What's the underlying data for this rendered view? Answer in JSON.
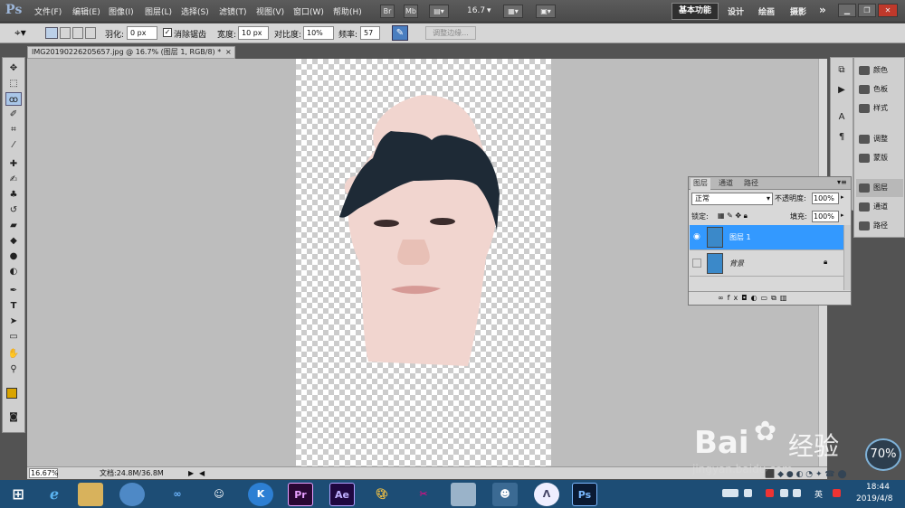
{
  "app": {
    "logo": "Ps"
  },
  "menu": [
    "文件(F)",
    "编辑(E)",
    "图像(I)",
    "图层(L)",
    "选择(S)",
    "滤镜(T)",
    "视图(V)",
    "窗口(W)",
    "帮助(H)"
  ],
  "appbar": {
    "br": "Br",
    "mb": "Mb",
    "zoom": "16.7",
    "workspaces": [
      "基本功能",
      "设计",
      "绘画",
      "摄影"
    ],
    "more": "»"
  },
  "options": {
    "feather_label": "羽化:",
    "feather_value": "0 px",
    "antialias_label": "消除锯齿",
    "width_label": "宽度:",
    "width_value": "10 px",
    "contrast_label": "对比度:",
    "contrast_value": "10%",
    "freq_label": "频率:",
    "freq_value": "57",
    "refine_label": "调整边缘..."
  },
  "document": {
    "tab_title": "IMG20190226205657.jpg @ 16.7% (图层 1, RGB/8) *",
    "close": "×"
  },
  "status": {
    "zoom": "16.67%",
    "doc": "文档:24.8M/36.8M"
  },
  "panels": {
    "right_items": [
      "颜色",
      "色板",
      "样式",
      "调整",
      "蒙版",
      "图层",
      "通道",
      "路径"
    ]
  },
  "layers_panel": {
    "tabs": [
      "图层",
      "通道",
      "路径"
    ],
    "blend_mode": "正常",
    "opacity_label": "不透明度:",
    "opacity_value": "100%",
    "lock_label": "锁定:",
    "fill_label": "填充:",
    "fill_value": "100%",
    "layers": [
      {
        "name": "图层 1",
        "selected": true,
        "visible": true
      },
      {
        "name": "背景",
        "selected": false,
        "visible": false,
        "locked": true
      }
    ]
  },
  "taskbar": {
    "icons": [
      "windows-start",
      "ie",
      "explorer",
      "browser",
      "baidu-netdisk",
      "panda",
      "kugou",
      "premiere",
      "aftereffects",
      "paint",
      "scissors",
      "calculator",
      "qq",
      "arrow-app",
      "photoshop"
    ],
    "apps": {
      "pr": "Pr",
      "ae": "Ae",
      "ps": "Ps",
      "k": "K"
    },
    "clock_time": "18:44",
    "clock_date": "2019/4/8",
    "lang": "英"
  },
  "watermark": {
    "brand": "Bai",
    "brand2": "经验",
    "url": "jingyan.baidu.com",
    "progress": "70%"
  },
  "colors": {
    "accent": "#3399ff",
    "fg_swatch": "#d9a400",
    "taskbar": "#1d4d75"
  }
}
